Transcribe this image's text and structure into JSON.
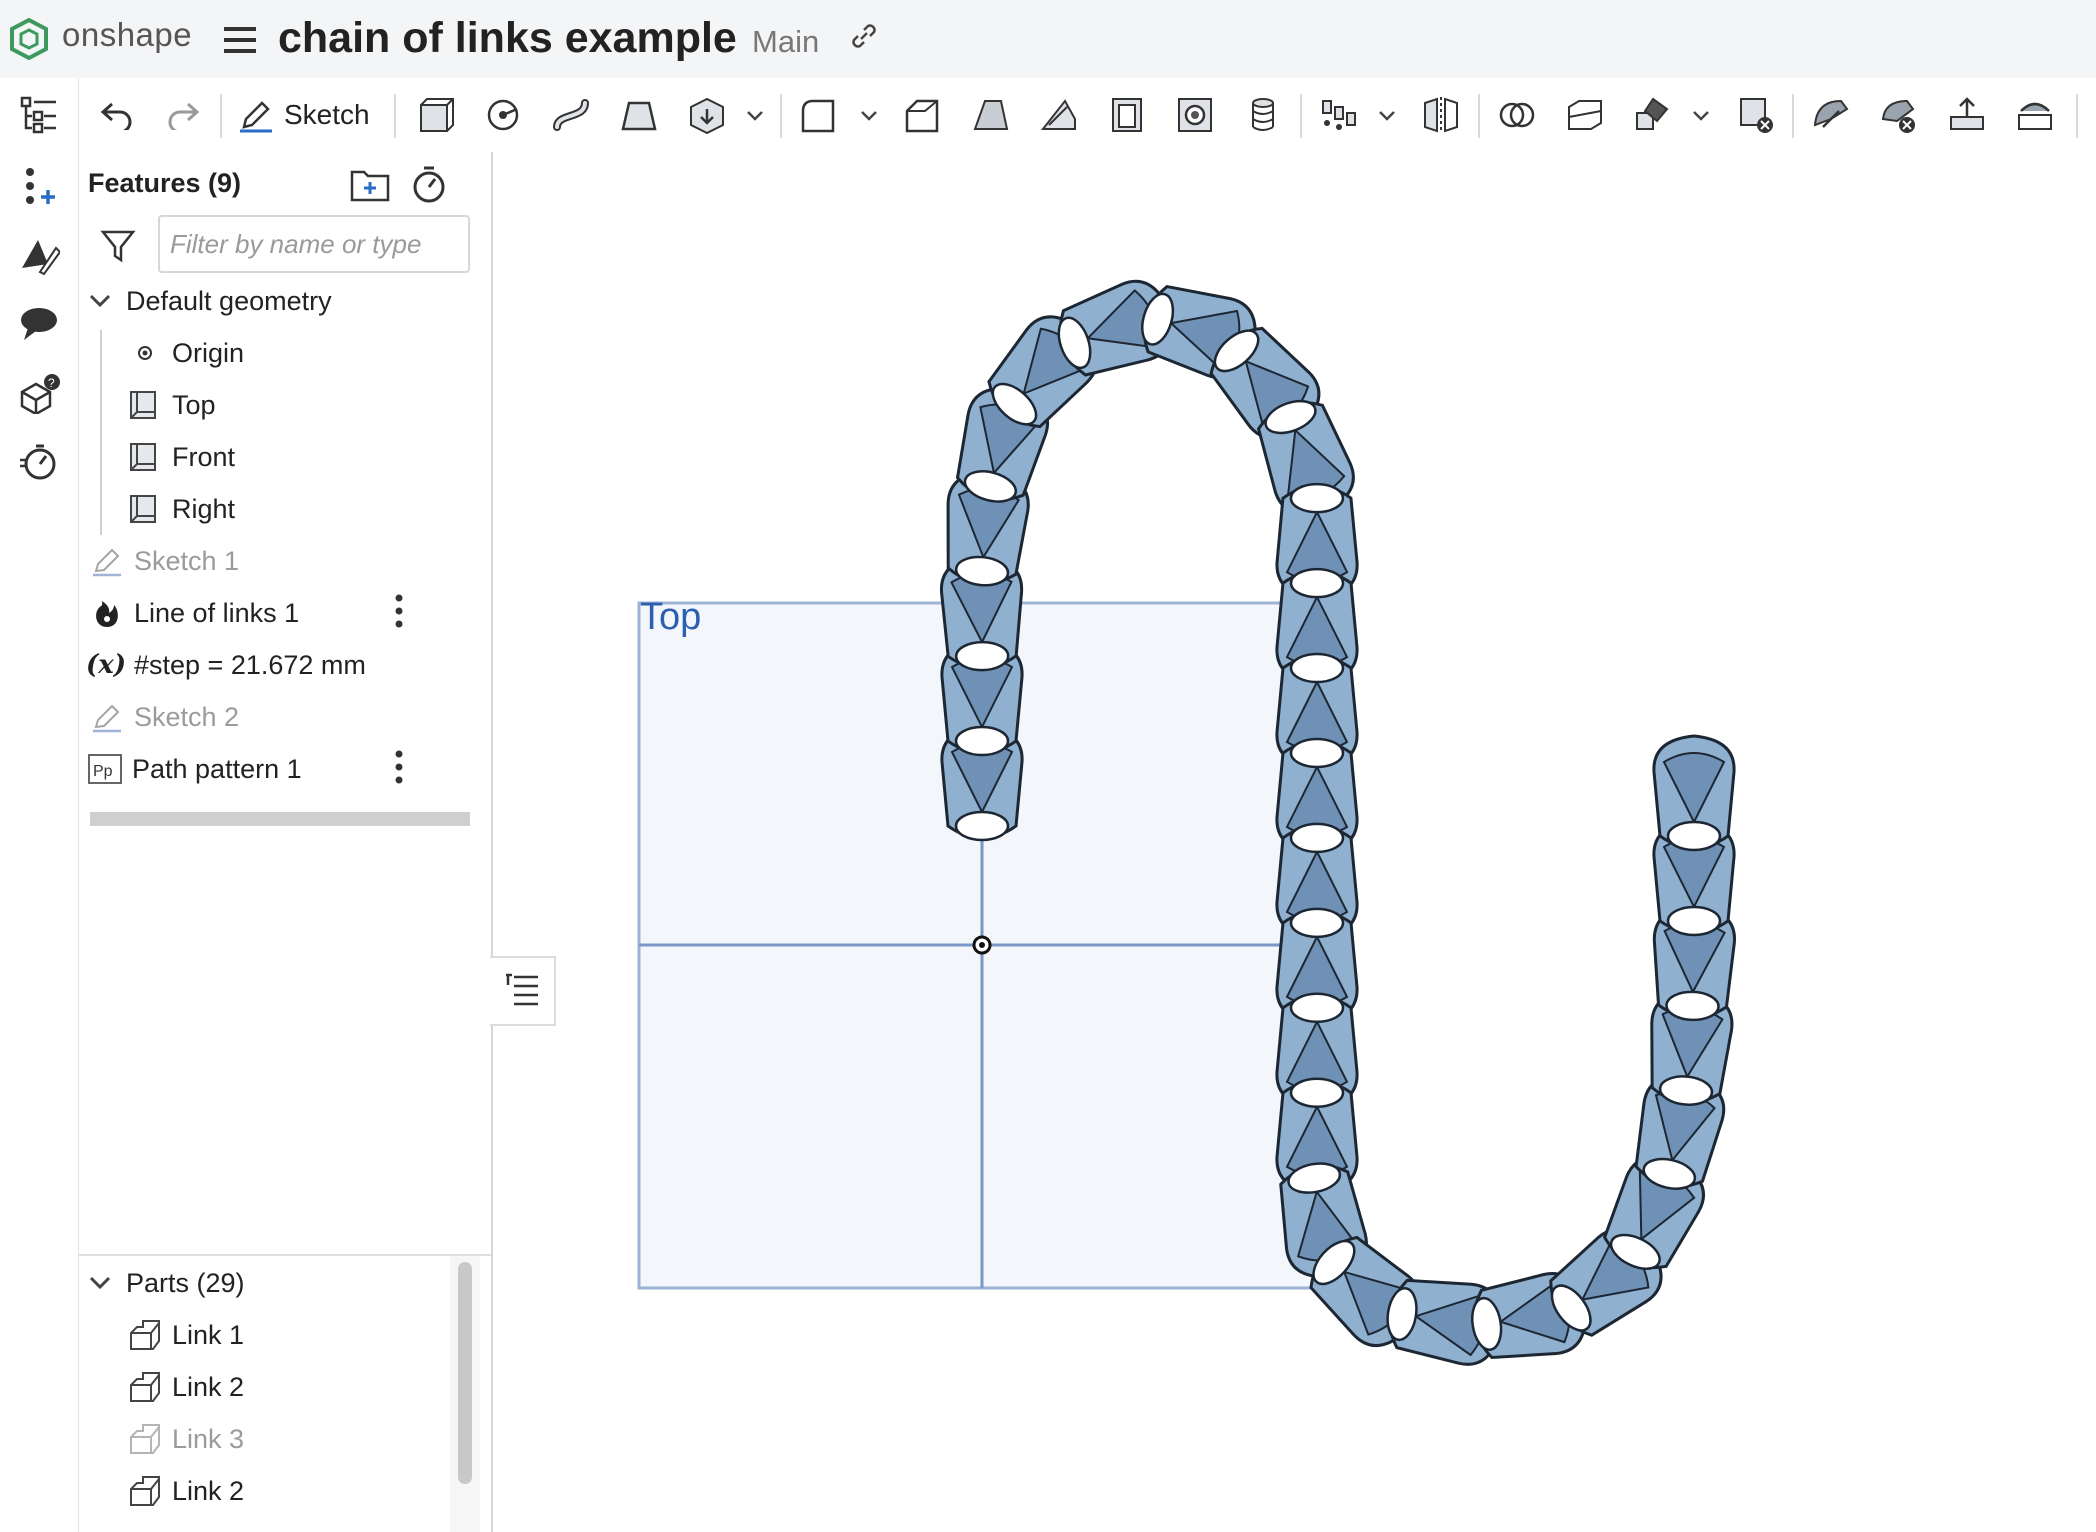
{
  "app": {
    "logo_text": "onshape",
    "document_title": "chain of links example",
    "branch": "Main"
  },
  "toolbar": {
    "sketch_label": "Sketch",
    "tools": [
      "undo-icon",
      "redo-icon",
      "sketch-icon",
      "extrude-icon",
      "revolve-icon",
      "sweep-icon",
      "loft-icon",
      "thicken-icon",
      "fillet-icon",
      "chamfer-icon",
      "draft-icon",
      "rib-icon",
      "shell-icon",
      "hole-icon",
      "thread-icon",
      "pattern-icon",
      "mirror-icon",
      "boolean-icon",
      "split-icon",
      "transform-icon",
      "delete-part-icon",
      "modify-fillet-icon",
      "delete-face-icon",
      "move-face-icon",
      "replace-face-icon"
    ]
  },
  "rail": {
    "items": [
      "feature-list-icon",
      "insert-feature-icon",
      "appearance-icon",
      "comment-icon",
      "mass-properties-icon",
      "rollback-history-icon"
    ]
  },
  "features": {
    "title": "Features (9)",
    "filter_placeholder": "Filter by name or type",
    "default_geometry_label": "Default geometry",
    "items": [
      {
        "label": "Origin",
        "icon": "origin-icon",
        "muted": false
      },
      {
        "label": "Top",
        "icon": "plane-icon",
        "muted": false
      },
      {
        "label": "Front",
        "icon": "plane-icon",
        "muted": false
      },
      {
        "label": "Right",
        "icon": "plane-icon",
        "muted": false
      },
      {
        "label": "Sketch 1",
        "icon": "sketch-icon",
        "muted": true
      },
      {
        "label": "Line of links 1",
        "icon": "custom-feature-icon",
        "muted": false
      },
      {
        "label": "#step = 21.672 mm",
        "icon": "variable-icon",
        "muted": false
      },
      {
        "label": "Sketch 2",
        "icon": "sketch-icon",
        "muted": true
      },
      {
        "label": "Path pattern 1",
        "icon": "path-pattern-icon",
        "muted": false
      }
    ]
  },
  "parts": {
    "title": "Parts (29)",
    "items": [
      {
        "label": "Link 1",
        "muted": false
      },
      {
        "label": "Link 2",
        "muted": false
      },
      {
        "label": "Link 3",
        "muted": true
      },
      {
        "label": "Link 2",
        "muted": false
      }
    ]
  },
  "viewport": {
    "plane_label": "Top",
    "link_color": "#8fb0cf",
    "plane_color": "#7a98c7",
    "chain_link_count": 29
  }
}
